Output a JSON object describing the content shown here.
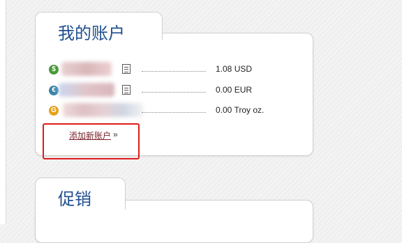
{
  "accounts_panel": {
    "title": "我的账户",
    "accounts": [
      {
        "icon": "dollar-coin-icon",
        "symbol": "$",
        "color": "#4a9a3a",
        "balance": "1.08 USD"
      },
      {
        "icon": "euro-coin-icon",
        "symbol": "€",
        "color": "#3a84a6",
        "balance": "0.00 EUR"
      },
      {
        "icon": "gold-coin-icon",
        "symbol": "G",
        "color": "#e5a21a",
        "balance": "0.00 Troy oz."
      }
    ],
    "add_account_label": "添加新账户",
    "add_account_arrow": "»"
  },
  "promo_panel": {
    "title": "促销"
  },
  "colors": {
    "title": "#1f4f8f",
    "link": "#7a1f2a",
    "highlight": "#e01b1b"
  }
}
